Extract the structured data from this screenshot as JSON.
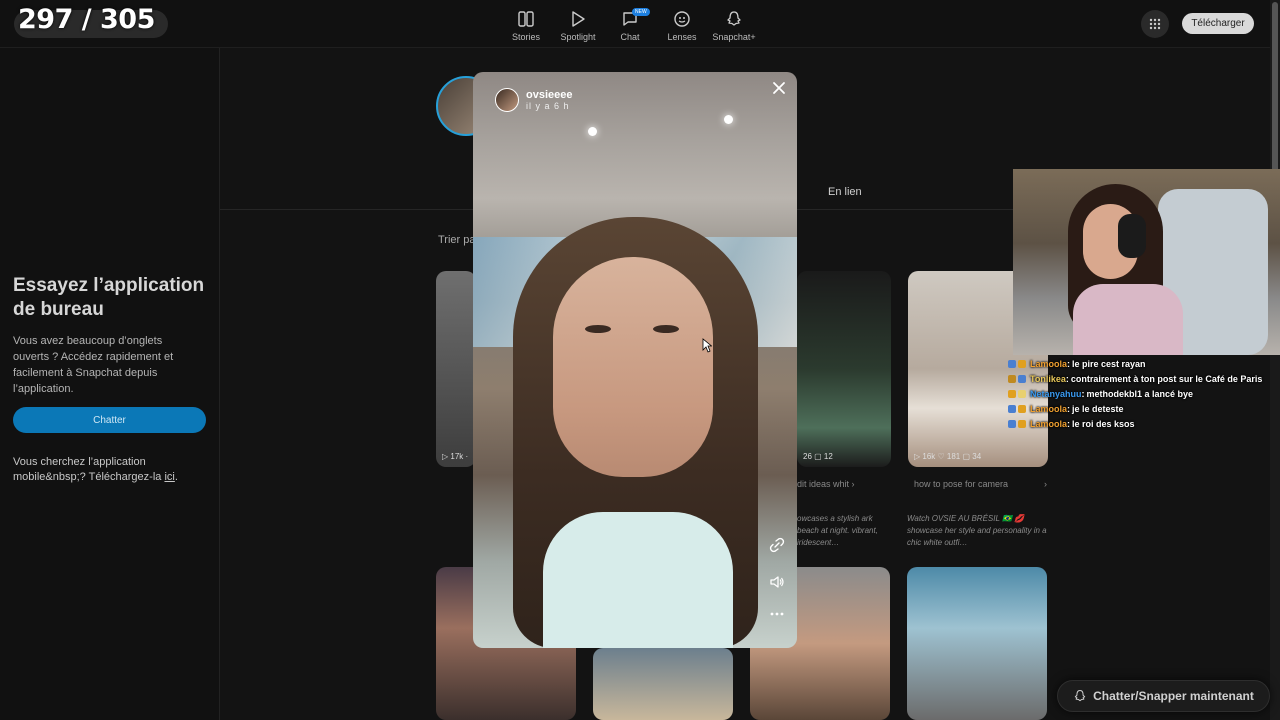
{
  "overlay_counter": "297 / 305",
  "nav": {
    "items": [
      {
        "label": "Stories",
        "icon": "stories-icon"
      },
      {
        "label": "Spotlight",
        "icon": "play-icon"
      },
      {
        "label": "Chat",
        "icon": "chat-icon",
        "badge": "NEW"
      },
      {
        "label": "Lenses",
        "icon": "lens-icon"
      },
      {
        "label": "Snapchat+",
        "icon": "ghost-icon"
      }
    ],
    "download_label": "Télécharger"
  },
  "sidebar": {
    "promo_title": "Essayez l’application de bureau",
    "promo_text": "Vous avez beaucoup d’onglets ouverts ? Accédez rapidement et facilement à Snapchat depuis l’application.",
    "chat_button": "Chatter",
    "mobile_text_prefix": "Vous cherchez l’application mobile&nbsp;? Téléchargez-la ",
    "mobile_link": "ici",
    "mobile_text_suffix": "."
  },
  "profile": {
    "tab_linked": "En lien",
    "sort_label": "Trier pa"
  },
  "cards": {
    "row1": [
      {
        "stats": "▷ 17k  ·"
      },
      {
        "stats": "26  ▢ 12"
      },
      {
        "stats": "▷ 16k  ♡ 181  ▢ 34"
      }
    ],
    "tags_mid": "dit ideas    whit   ›",
    "tags_right": "how to pose for camera",
    "tags_right_arrow": "›",
    "desc_mid": "owcases a stylish ark beach at night. vibrant, iridescent…",
    "desc_right": "Watch OVSIE AU BRÉSIL 🇧🇷 💋 showcase her style and personality in a chic white outfi…"
  },
  "viewer": {
    "username": "ovsieeee",
    "timestamp": "il y a 6 h"
  },
  "chat_messages": [
    {
      "user": "Lamoola",
      "user_color": "#f0a030",
      "message": "le pire cest rayan"
    },
    {
      "user": "Tonlikea",
      "user_color": "#e8c85a",
      "message": "contrairement à ton post sur le Café de Paris"
    },
    {
      "user": "Netanyahuu",
      "user_color": "#3a9af0",
      "message": "methodekbl1 a lancé bye"
    },
    {
      "user": "Lamoola",
      "user_color": "#f0a030",
      "message": "je le deteste"
    },
    {
      "user": "Lamoola",
      "user_color": "#f0a030",
      "message": "le roi des ksos"
    }
  ],
  "cta_label": "Chatter/Snapper maintenant",
  "colors": {
    "accent": "#0b78b7",
    "ring": "#27a0d9",
    "background": "#131313"
  }
}
